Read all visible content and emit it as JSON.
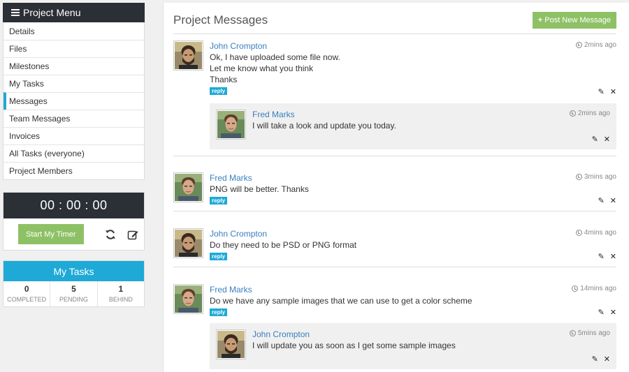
{
  "sidebar": {
    "menu_title": "Project Menu",
    "items": [
      {
        "label": "Details"
      },
      {
        "label": "Files"
      },
      {
        "label": "Milestones"
      },
      {
        "label": "My Tasks"
      },
      {
        "label": "Messages",
        "active": true
      },
      {
        "label": "Team Messages"
      },
      {
        "label": "Invoices"
      },
      {
        "label": "All Tasks (everyone)"
      },
      {
        "label": "Project Members"
      }
    ],
    "timer": {
      "display": "00 : 00 : 00",
      "start_label": "Start My Timer",
      "icons": [
        "refresh-icon",
        "edit-icon"
      ]
    },
    "tasks": {
      "title": "My Tasks",
      "stats": [
        {
          "value": "0",
          "label": "COMPLETED"
        },
        {
          "value": "5",
          "label": "PENDING"
        },
        {
          "value": "1",
          "label": "BEHIND"
        }
      ]
    }
  },
  "main": {
    "title": "Project Messages",
    "post_button": "Post New Message",
    "reply_label": "reply",
    "messages": [
      {
        "author": "John Crompton",
        "time": "2mins ago",
        "lines": [
          "Ok, I have uploaded some file now.",
          "Let me know what you think",
          "Thanks"
        ],
        "reply": {
          "author": "Fred Marks",
          "time": "2mins ago",
          "lines": [
            "I will take a look and update you today."
          ]
        }
      },
      {
        "author": "Fred Marks",
        "time": "3mins ago",
        "lines": [
          "PNG will be better. Thanks"
        ]
      },
      {
        "author": "John Crompton",
        "time": "4mins ago",
        "lines": [
          "Do they need to be PSD or PNG format"
        ]
      },
      {
        "author": "Fred Marks",
        "time": "14mins ago",
        "lines": [
          "Do we have any sample images that we can use to get a color scheme"
        ],
        "reply": {
          "author": "John Crompton",
          "time": "5mins ago",
          "lines": [
            "I will update you as soon as I get some sample images"
          ]
        }
      }
    ]
  },
  "colors": {
    "accent_blue": "#1fa9d6",
    "green": "#8ec165",
    "dark": "#2b2f36",
    "link": "#3a7fbf"
  }
}
